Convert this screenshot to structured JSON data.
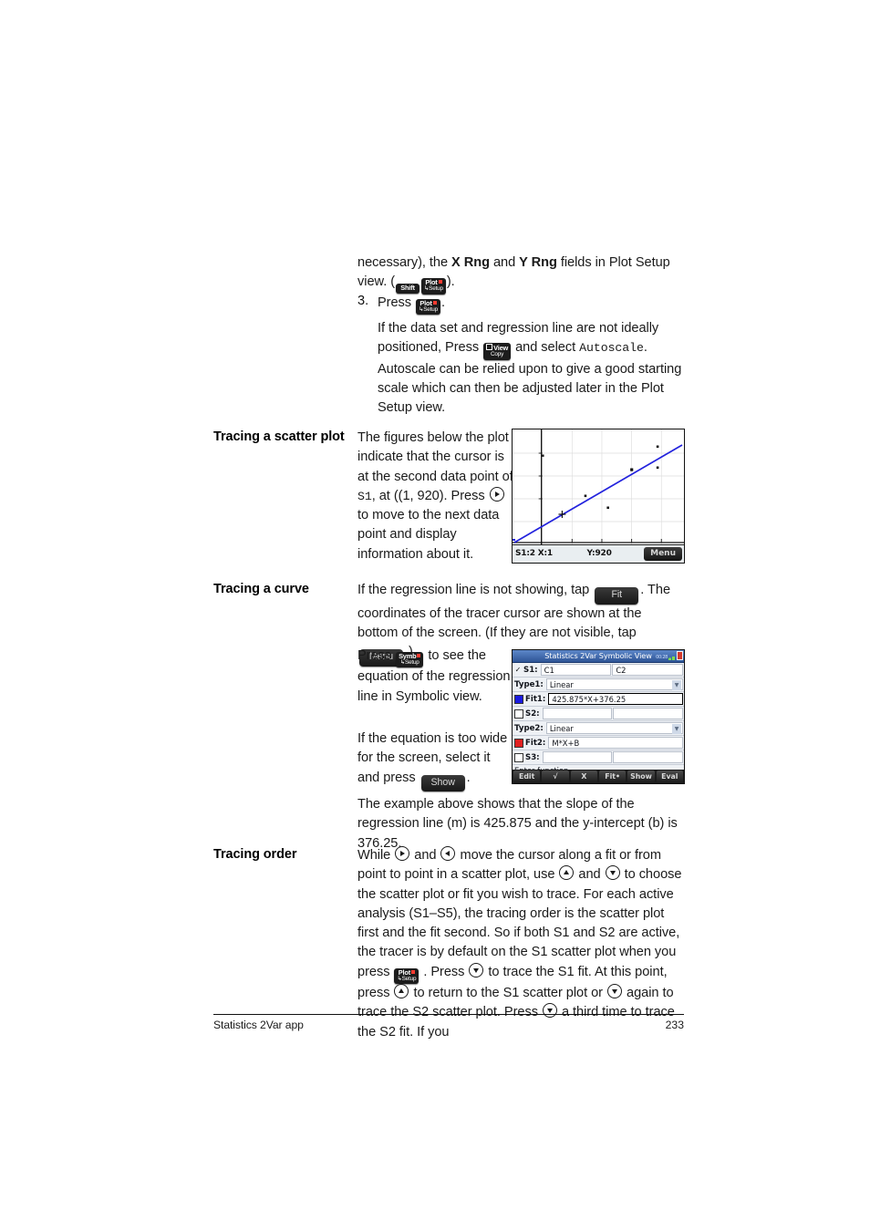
{
  "document": {
    "footer_left": "Statistics 2Var app",
    "footer_page": "233"
  },
  "content": {
    "para_necessary": {
      "text_a": "necessary), the ",
      "bold_x": "X Rng",
      "text_b": " and ",
      "bold_y": "Y Rng",
      "text_c": " fields in Plot Setup view. (",
      "text_d": ")."
    },
    "step3": {
      "number": "3.",
      "press_label": "Press",
      "period": ".",
      "continuation_a": "If the data set and regression line are not ideally positioned, Press",
      "continuation_b": "and select",
      "autoscale": "Autoscale",
      "continuation_c": ". Autoscale can be relied upon to give a good starting scale which can then be adjusted later in the Plot Setup view."
    },
    "tracing_scatter": {
      "heading": "Tracing a scatter plot",
      "text_a": "The figures below the plot indicate that the cursor is at the second data point of ",
      "mono_s1": "S1",
      "text_b": ", at ((1, 920). Press ",
      "text_c": " to move to the next data point and display information about it."
    },
    "tracing_curve": {
      "heading": "Tracing a curve",
      "text_a": "If the regression line is not showing, tap ",
      "btn_fit": "Fit",
      "text_b": ". The coordinates of the tracer cursor are shown at the bottom of the screen. (If they are not visible, tap ",
      "btn_menu": "Menu",
      "text_c": ".)",
      "symb_text_a": "Press ",
      "symb_text_b": " to see the equation of the regression line in Symbolic view.",
      "toowide_a": "If the equation is too wide for the screen, select it and press ",
      "btn_show": "Show",
      "toowide_b": ".",
      "example": "The example above shows that the slope of the regression line (m) is 425.875 and the y-intercept (b) is 376.25."
    },
    "tracing_order": {
      "heading": "Tracing order",
      "t1": "While ",
      "t2": " and ",
      "t3": " move the cursor along a fit or from point to point in a scatter plot, use ",
      "t4": " and ",
      "t5": " to choose the scatter plot or fit you wish to trace. For each active analysis (S1–S5), the tracing order is the scatter plot first and the fit second. So if both S1 and S2 are active, the tracer is by default on the S1 scatter plot when you press ",
      "t6": " . Press ",
      "t7": " to trace the S1 fit. At this point, press ",
      "t8": " to return to the S1 scatter plot or ",
      "t9": " again to trace the S2 scatter plot. Press ",
      "t10": " a third time to trace the S2 fit. If you"
    }
  },
  "keys": {
    "shift": {
      "line1": "Shift",
      "line2": ""
    },
    "plot_setup": {
      "line1": "Plot",
      "line2": "Setup"
    },
    "view_copy": {
      "line1": "View",
      "line2": "Copy"
    },
    "symb_setup": {
      "line1": "Symb",
      "line2": "Setup"
    }
  },
  "calc_plot": {
    "status_left": "S1:2 X:1",
    "status_mid": "Y:920",
    "menu_button": "Menu",
    "line_color": "#2222dd"
  },
  "calc_symbolic": {
    "title": "Statistics 2Var Symbolic View",
    "status_text": "00:28",
    "rows": [
      {
        "label": "S1:",
        "checked": true,
        "field1": "C1",
        "field2": "C2"
      },
      {
        "label": "Type1:",
        "value": "Linear",
        "dropdown": true
      },
      {
        "label": "Fit1:",
        "swatch": "#1a1ae0",
        "value": "425.875*X+376.25",
        "selected": true
      },
      {
        "label": "S2:",
        "checked": false,
        "field1": "",
        "field2": ""
      },
      {
        "label": "Type2:",
        "value": "Linear",
        "dropdown": true
      },
      {
        "label": "Fit2:",
        "swatch": "#e02020",
        "value": "M*X+B",
        "selected": false
      },
      {
        "label": "S3:",
        "checked": false,
        "field1": "",
        "field2": ""
      }
    ],
    "hint": "Enter function",
    "menu": [
      "Edit",
      "√",
      "X",
      "Fit•",
      "Show",
      "Eval"
    ]
  },
  "chart_data": {
    "type": "scatter",
    "title": "",
    "xlabel": "",
    "ylabel": "",
    "points": [
      {
        "x": 0.55,
        "y": 0.345
      },
      {
        "x": 1.0,
        "y": 0.215
      },
      {
        "x": 1.52,
        "y": 0.66
      },
      {
        "x": 1.87,
        "y": 0.56
      },
      {
        "x": 2.34,
        "y": 0.79
      },
      {
        "x": 2.88,
        "y": 0.955
      },
      {
        "x": 2.88,
        "y": 0.77
      }
    ],
    "cursor_point": {
      "x": 1.0,
      "y": 0.215,
      "label": "S1:2 X:1 Y:920"
    },
    "fit_line": {
      "type": "linear",
      "equation": "425.875*X+376.25",
      "slope": 425.875,
      "intercept": 376.25
    },
    "grid": true,
    "legend": "none"
  }
}
